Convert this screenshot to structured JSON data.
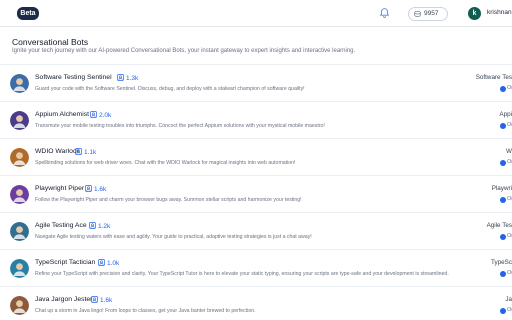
{
  "header": {
    "badge": "Beta",
    "credits": "9957",
    "user_initial": "k",
    "username": "krishnanu"
  },
  "page": {
    "title": "Conversational Bots",
    "subtitle": "Ignite your tech journey with our AI-powered Conversational Bots, your instant gateway to expert insights and interactive learning."
  },
  "bots": [
    {
      "name": "Software Testing Sentinel",
      "users": "1.3k",
      "desc": "Guard your code with the Software Sentinel. Discuss, debug, and deploy with a stalwart champion of software quality!",
      "tag": "Software Tes",
      "status": "Or",
      "color": "#3b6ea8"
    },
    {
      "name": "Appium Alchemist",
      "users": "2.0k",
      "desc": "Transmute your mobile testing troubles into triumphs. Concoct the perfect Appium solutions with your mystical mobile maestro!",
      "tag": "Appi",
      "status": "Or",
      "color": "#4a3b8c"
    },
    {
      "name": "WDIO Warlock",
      "users": "1.1k",
      "desc": "Spellbinding solutions for web driver woes. Chat with the WDIO Warlock for magical insights into web automation!",
      "tag": "W",
      "status": "Or",
      "color": "#b06a2a"
    },
    {
      "name": "Playwright Piper",
      "users": "1.6k",
      "desc": "Follow the Playwright Piper and charm your browser bugs away. Summon stellar scripts and harmonize your testing!",
      "tag": "Playwri",
      "status": "Or",
      "color": "#6a3fa0"
    },
    {
      "name": "Agile Testing Ace",
      "users": "1.2k",
      "desc": "Navigate Agile testing waters with ease and agility. Your guide to practical, adaptive testing strategies is just a chat away!",
      "tag": "Agile Tes",
      "status": "Or",
      "color": "#2f6f8f"
    },
    {
      "name": "TypeScript Tactician",
      "users": "1.0k",
      "desc": "Refine your TypeScript with precision and clarity. Your TypeScript Tutor is here to elevate your static typing, ensuring your scripts are type-safe and your development is streamlined.",
      "tag": "TypeSc",
      "status": "Or",
      "color": "#2a7fa8"
    },
    {
      "name": "Java Jargon Jester",
      "users": "1.6k",
      "desc": "Chat up a storm in Java lingo! From loops to classes, get your Java banter brewed to perfection.",
      "tag": "Ja",
      "status": "Or",
      "color": "#8a5a3a"
    }
  ]
}
